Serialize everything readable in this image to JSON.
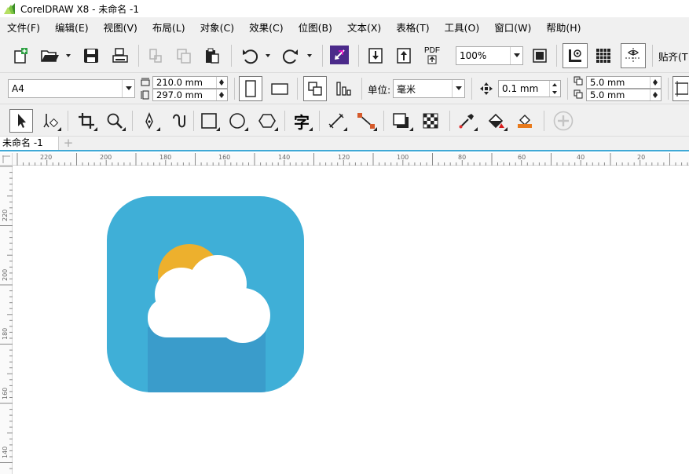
{
  "app": {
    "title": "CorelDRAW X8 - 未命名 -1",
    "icon": "coreldraw-logo-icon",
    "brand_color": "#6cbb3c"
  },
  "menu": [
    {
      "id": "file",
      "label": "文件(F)"
    },
    {
      "id": "edit",
      "label": "编辑(E)"
    },
    {
      "id": "view",
      "label": "视图(V)"
    },
    {
      "id": "layout",
      "label": "布局(L)"
    },
    {
      "id": "object",
      "label": "对象(C)"
    },
    {
      "id": "effects",
      "label": "效果(C)"
    },
    {
      "id": "bitmaps",
      "label": "位图(B)"
    },
    {
      "id": "text",
      "label": "文本(X)"
    },
    {
      "id": "table",
      "label": "表格(T)"
    },
    {
      "id": "tools",
      "label": "工具(O)"
    },
    {
      "id": "window",
      "label": "窗口(W)"
    },
    {
      "id": "help",
      "label": "帮助(H)"
    }
  ],
  "standard_toolbar": {
    "icons": [
      "new-document-icon",
      "open-folder-icon",
      "save-icon",
      "print-icon",
      "cut-icon",
      "copy-icon",
      "paste-icon",
      "undo-icon",
      "redo-icon",
      "search-content-icon",
      "import-icon",
      "export-icon",
      "publish-pdf-icon",
      "full-screen-preview-icon",
      "show-rulers-icon",
      "show-grid-icon",
      "show-guidelines-icon"
    ],
    "pdf_label": "PDF",
    "zoom_value": "100%",
    "snap_to_label": "贴齐(T"
  },
  "property_bar": {
    "page_size": "A4",
    "width": "210.0 mm",
    "height": "297.0 mm",
    "units_label": "单位:",
    "units_value": "毫米",
    "nudge": "0.1 mm",
    "dup_x": "5.0 mm",
    "dup_y": "5.0 mm"
  },
  "toolbox": {
    "icons": [
      "pick-tool-icon",
      "shape-tool-icon",
      "crop-tool-icon",
      "zoom-tool-icon",
      "freehand-tool-icon",
      "artistic-media-icon",
      "rectangle-tool-icon",
      "ellipse-tool-icon",
      "polygon-tool-icon",
      "text-tool-icon",
      "parallel-dimension-icon",
      "connector-tool-icon",
      "drop-shadow-icon",
      "transparency-icon",
      "eyedropper-icon",
      "interactive-fill-icon",
      "smart-fill-icon",
      "add-tool-icon"
    ],
    "text_tool_glyph": "字"
  },
  "document_tabs": [
    {
      "label": "未命名 -1",
      "active": true
    }
  ],
  "rulers": {
    "horizontal": [
      "220",
      "200",
      "180",
      "160",
      "140",
      "120",
      "100",
      "80",
      "60",
      "40",
      "20"
    ],
    "vertical": [
      "220",
      "200",
      "180",
      "160",
      "140"
    ]
  },
  "artwork": {
    "name": "weather-app-icon",
    "tile_color": "#3fafd7",
    "tile_shadow_color": "#3a9ccb",
    "sun_color": "#edb02d",
    "cloud_color": "#ffffff"
  }
}
